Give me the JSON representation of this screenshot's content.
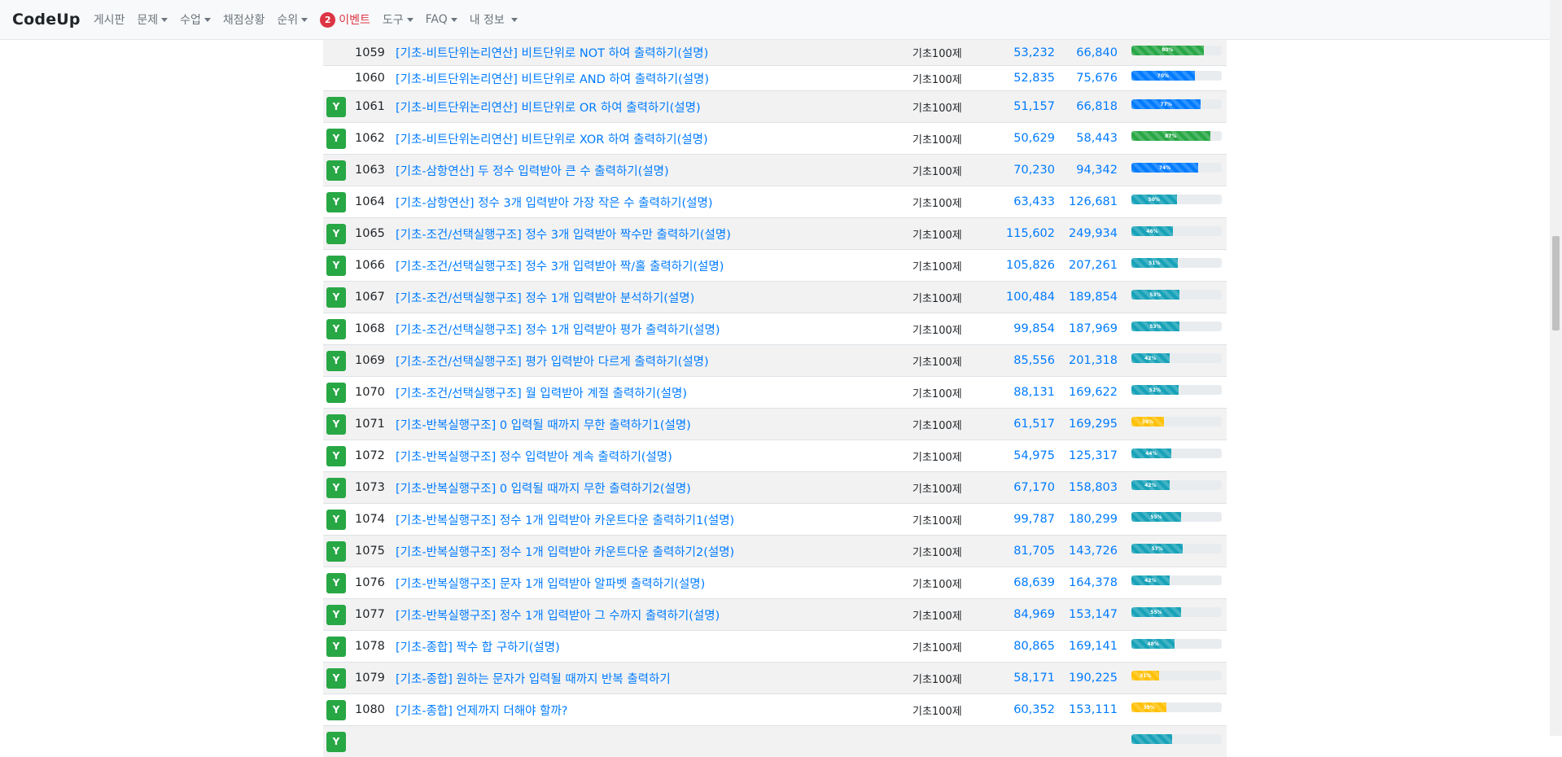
{
  "navbar": {
    "brand": "CodeUp",
    "items": [
      {
        "label": "게시판",
        "dropdown": false
      },
      {
        "label": "문제",
        "dropdown": true
      },
      {
        "label": "수업",
        "dropdown": true
      },
      {
        "label": "채점상황",
        "dropdown": false
      },
      {
        "label": "순위",
        "dropdown": true
      }
    ],
    "event": {
      "badge": "2",
      "label": "이벤트"
    },
    "items_after": [
      {
        "label": "도구",
        "dropdown": true
      },
      {
        "label": "FAQ",
        "dropdown": true
      },
      {
        "label": "내 정보",
        "dropdown": true
      }
    ]
  },
  "colors": {
    "link": "#007bff",
    "solved": "#28a745",
    "danger": "#dc3545",
    "green": "#28a745",
    "blue": "#007bff",
    "teal": "#17a2b8",
    "yellow": "#ffc107"
  },
  "solved_mark": "Y",
  "problems": [
    {
      "id": "1059",
      "title": "[기초-비트단위논리연산] 비트단위로 NOT 하여 출력하기(설명)",
      "category": "기초100제",
      "accepted": "53,232",
      "submitted": "66,840",
      "rate": 80,
      "rate_label": "80%",
      "color": "green",
      "solved": false
    },
    {
      "id": "1060",
      "title": "[기초-비트단위논리연산] 비트단위로 AND 하여 출력하기(설명)",
      "category": "기초100제",
      "accepted": "52,835",
      "submitted": "75,676",
      "rate": 70,
      "rate_label": "70%",
      "color": "blue",
      "solved": false
    },
    {
      "id": "1061",
      "title": "[기초-비트단위논리연산] 비트단위로 OR 하여 출력하기(설명)",
      "category": "기초100제",
      "accepted": "51,157",
      "submitted": "66,818",
      "rate": 77,
      "rate_label": "77%",
      "color": "blue",
      "solved": true
    },
    {
      "id": "1062",
      "title": "[기초-비트단위논리연산] 비트단위로 XOR 하여 출력하기(설명)",
      "category": "기초100제",
      "accepted": "50,629",
      "submitted": "58,443",
      "rate": 87,
      "rate_label": "87%",
      "color": "green",
      "solved": true
    },
    {
      "id": "1063",
      "title": "[기초-삼항연산] 두 정수 입력받아 큰 수 출력하기(설명)",
      "category": "기초100제",
      "accepted": "70,230",
      "submitted": "94,342",
      "rate": 74,
      "rate_label": "74%",
      "color": "blue",
      "solved": true
    },
    {
      "id": "1064",
      "title": "[기초-삼항연산] 정수 3개 입력받아 가장 작은 수 출력하기(설명)",
      "category": "기초100제",
      "accepted": "63,433",
      "submitted": "126,681",
      "rate": 50,
      "rate_label": "50%",
      "color": "teal",
      "solved": true
    },
    {
      "id": "1065",
      "title": "[기초-조건/선택실행구조] 정수 3개 입력받아 짝수만 출력하기(설명)",
      "category": "기초100제",
      "accepted": "115,602",
      "submitted": "249,934",
      "rate": 46,
      "rate_label": "46%",
      "color": "teal",
      "solved": true
    },
    {
      "id": "1066",
      "title": "[기초-조건/선택실행구조] 정수 3개 입력받아 짝/홀 출력하기(설명)",
      "category": "기초100제",
      "accepted": "105,826",
      "submitted": "207,261",
      "rate": 51,
      "rate_label": "51%",
      "color": "teal",
      "solved": true
    },
    {
      "id": "1067",
      "title": "[기초-조건/선택실행구조] 정수 1개 입력받아 분석하기(설명)",
      "category": "기초100제",
      "accepted": "100,484",
      "submitted": "189,854",
      "rate": 53,
      "rate_label": "53%",
      "color": "teal",
      "solved": true
    },
    {
      "id": "1068",
      "title": "[기초-조건/선택실행구조] 정수 1개 입력받아 평가 출력하기(설명)",
      "category": "기초100제",
      "accepted": "99,854",
      "submitted": "187,969",
      "rate": 53,
      "rate_label": "53%",
      "color": "teal",
      "solved": true
    },
    {
      "id": "1069",
      "title": "[기초-조건/선택실행구조] 평가 입력받아 다르게 출력하기(설명)",
      "category": "기초100제",
      "accepted": "85,556",
      "submitted": "201,318",
      "rate": 42,
      "rate_label": "42%",
      "color": "teal",
      "solved": true
    },
    {
      "id": "1070",
      "title": "[기초-조건/선택실행구조] 월 입력받아 계절 출력하기(설명)",
      "category": "기초100제",
      "accepted": "88,131",
      "submitted": "169,622",
      "rate": 52,
      "rate_label": "52%",
      "color": "teal",
      "solved": true
    },
    {
      "id": "1071",
      "title": "[기초-반복실행구조] 0 입력될 때까지 무한 출력하기1(설명)",
      "category": "기초100제",
      "accepted": "61,517",
      "submitted": "169,295",
      "rate": 36,
      "rate_label": "36%",
      "color": "yellow",
      "solved": true
    },
    {
      "id": "1072",
      "title": "[기초-반복실행구조] 정수 입력받아 계속 출력하기(설명)",
      "category": "기초100제",
      "accepted": "54,975",
      "submitted": "125,317",
      "rate": 44,
      "rate_label": "44%",
      "color": "teal",
      "solved": true
    },
    {
      "id": "1073",
      "title": "[기초-반복실행구조] 0 입력될 때까지 무한 출력하기2(설명)",
      "category": "기초100제",
      "accepted": "67,170",
      "submitted": "158,803",
      "rate": 42,
      "rate_label": "42%",
      "color": "teal",
      "solved": true
    },
    {
      "id": "1074",
      "title": "[기초-반복실행구조] 정수 1개 입력받아 카운트다운 출력하기1(설명)",
      "category": "기초100제",
      "accepted": "99,787",
      "submitted": "180,299",
      "rate": 55,
      "rate_label": "55%",
      "color": "teal",
      "solved": true
    },
    {
      "id": "1075",
      "title": "[기초-반복실행구조] 정수 1개 입력받아 카운트다운 출력하기2(설명)",
      "category": "기초100제",
      "accepted": "81,705",
      "submitted": "143,726",
      "rate": 57,
      "rate_label": "57%",
      "color": "teal",
      "solved": true
    },
    {
      "id": "1076",
      "title": "[기초-반복실행구조] 문자 1개 입력받아 알파벳 출력하기(설명)",
      "category": "기초100제",
      "accepted": "68,639",
      "submitted": "164,378",
      "rate": 42,
      "rate_label": "42%",
      "color": "teal",
      "solved": true
    },
    {
      "id": "1077",
      "title": "[기초-반복실행구조] 정수 1개 입력받아 그 수까지 출력하기(설명)",
      "category": "기초100제",
      "accepted": "84,969",
      "submitted": "153,147",
      "rate": 55,
      "rate_label": "55%",
      "color": "teal",
      "solved": true
    },
    {
      "id": "1078",
      "title": "[기초-종합] 짝수 합 구하기(설명)",
      "category": "기초100제",
      "accepted": "80,865",
      "submitted": "169,141",
      "rate": 48,
      "rate_label": "48%",
      "color": "teal",
      "solved": true
    },
    {
      "id": "1079",
      "title": "[기초-종합] 원하는 문자가 입력될 때까지 반복 출력하기",
      "category": "기초100제",
      "accepted": "58,171",
      "submitted": "190,225",
      "rate": 31,
      "rate_label": "31%",
      "color": "yellow",
      "solved": true
    },
    {
      "id": "1080",
      "title": "[기초-종합] 언제까지 더해야 할까?",
      "category": "기초100제",
      "accepted": "60,352",
      "submitted": "153,111",
      "rate": 39,
      "rate_label": "39%",
      "color": "yellow",
      "solved": true
    },
    {
      "id": "",
      "title": "",
      "category": "",
      "accepted": "",
      "submitted": "",
      "rate": 45,
      "rate_label": "",
      "color": "teal",
      "solved": true
    }
  ]
}
